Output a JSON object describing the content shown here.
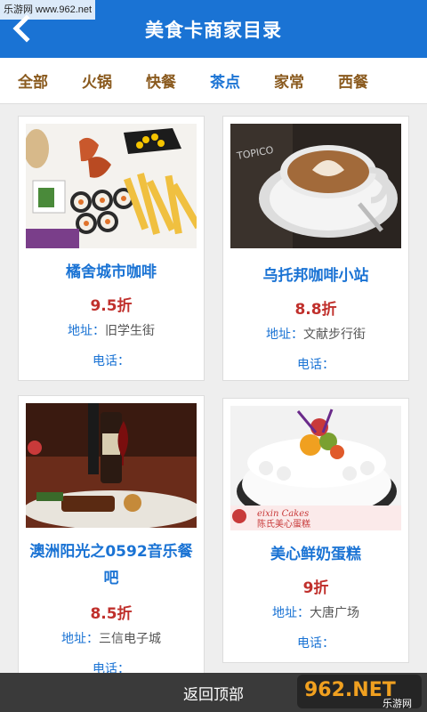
{
  "watermark": "乐游网 www.962.net",
  "header": {
    "title": "美食卡商家目录"
  },
  "tabs": [
    {
      "label": "全部"
    },
    {
      "label": "火锅"
    },
    {
      "label": "快餐"
    },
    {
      "label": "茶点"
    },
    {
      "label": "家常"
    },
    {
      "label": "西餐"
    }
  ],
  "active_tab": "茶点",
  "merchants": [
    {
      "name": "橘舍城市咖啡",
      "discount": "9.5折",
      "address_label": "地址：",
      "address": "旧学生街",
      "phone_label": "电话："
    },
    {
      "name": "乌托邦咖啡小站",
      "discount": "8.8折",
      "address_label": "地址：",
      "address": "文献步行街",
      "phone_label": "电话："
    },
    {
      "name_line1": "澳洲阳光之0592音乐餐",
      "name_line2": "吧",
      "discount": "8.5折",
      "address_label": "地址：",
      "address": "三信电子城",
      "phone_label": "电话："
    },
    {
      "name": "美心鲜奶蛋糕",
      "discount": "9折",
      "address_label": "地址：",
      "address": "大唐广场",
      "phone_label": "电话："
    }
  ],
  "cake_sign": {
    "line1": "eixin Cakes",
    "line2": "陈氏美心蛋糕"
  },
  "footer": {
    "back_to_top": "返回顶部"
  },
  "logo": {
    "text": "962.NET",
    "sub": "乐游网"
  },
  "colors": {
    "header": "#1a73d4",
    "tab_text": "#8a5a1e",
    "name": "#1a73d4",
    "discount": "#c0302c",
    "footer": "#3a3a3a"
  }
}
